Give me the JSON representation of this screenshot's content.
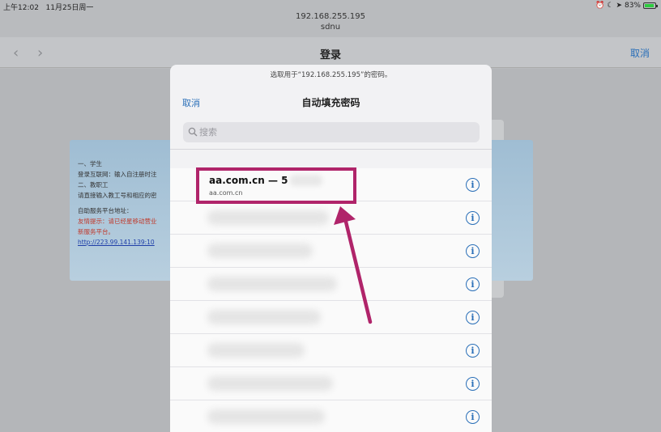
{
  "status_bar": {
    "time": "上午12:02",
    "date": "11月25日周一",
    "battery": "83%"
  },
  "url": {
    "host": "192.168.255.195",
    "site": "sdnu"
  },
  "nav": {
    "title": "登录",
    "cancel": "取消"
  },
  "background_page": {
    "lines": [
      "一、学生",
      "登录互联网：输入自注册时注",
      "二、教职工",
      "请直接输入教工号和相应的密",
      "自助服务平台地址：",
      "友情提示：请已经星移动营业",
      "新服务平台。",
      "http://223.99.141.139:10"
    ]
  },
  "sheet": {
    "prompt": "选取用于“192.168.255.195”的密码。",
    "cancel": "取消",
    "title": "自动填充密码",
    "search": {
      "placeholder": "搜索",
      "value": ""
    },
    "entries": [
      {
        "title": "aa.com.cn — 5",
        "subtitle": "aa.com.cn"
      },
      {
        "title": "",
        "subtitle": ""
      },
      {
        "title": "",
        "subtitle": ""
      },
      {
        "title": "",
        "subtitle": ""
      },
      {
        "title": "",
        "subtitle": ""
      },
      {
        "title": "",
        "subtitle": ""
      },
      {
        "title": "",
        "subtitle": ""
      },
      {
        "title": "",
        "subtitle": ""
      }
    ]
  },
  "annotation": {
    "color": "#b0246a"
  },
  "colors": {
    "accent": "#2a6fb8",
    "sheet_bg": "#f2f2f4"
  },
  "icons": {
    "info": "info-icon",
    "search": "search-icon",
    "back": "chevron-left-icon",
    "forward": "chevron-right-icon"
  }
}
